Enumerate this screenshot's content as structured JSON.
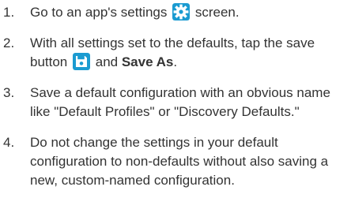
{
  "steps": [
    {
      "number": "1.",
      "text_before": "Go to an app's settings",
      "icon": "gear-icon",
      "text_after": "screen."
    },
    {
      "number": "2.",
      "text_before": "With all settings set to the defaults, tap the save button",
      "icon": "save-icon",
      "text_middle": "and",
      "emphasis": "Save As",
      "text_after": "."
    },
    {
      "number": "3.",
      "text": "Save a default configuration with an obvious name like \"Default Profiles\" or \"Discovery Defaults.\""
    },
    {
      "number": "4.",
      "text": "Do not change the settings in your default configuration to non-defaults without also saving a new, custom-named configuration."
    }
  ],
  "colors": {
    "text": "#333333",
    "icon_background": "#1b9bd1",
    "icon_foreground": "#ffffff"
  }
}
